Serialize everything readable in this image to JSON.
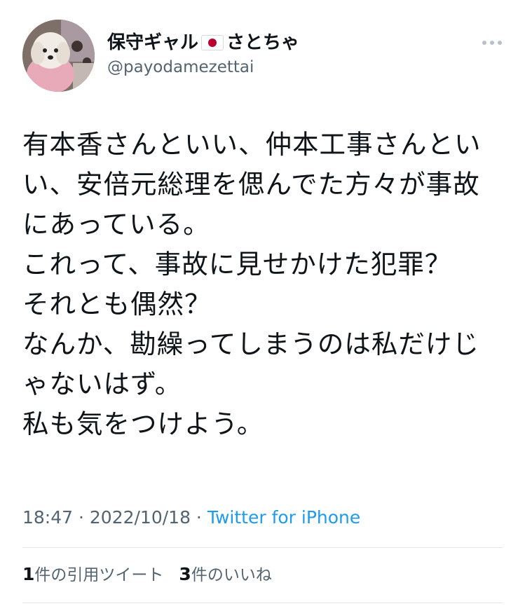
{
  "tweet": {
    "display_name_before_flag": "保守ギャル",
    "display_name_after_flag": "さとちゃ",
    "flag_icon": "japan-flag-icon",
    "handle": "@payodamezettai",
    "text": "有本香さんといい、仲本工事さんといい、安倍元総理を偲んでた方々が事故にあっている。\nこれって、事故に見せかけた犯罪？\nそれとも偶然？\nなんか、勘繰ってしまうのは私だけじゃないはず。\n私も気をつけよう。",
    "time": "18:47",
    "separator": " · ",
    "date": "2022/10/18",
    "source": "Twitter for iPhone",
    "quote_count": "1",
    "quote_label": "件の引用ツイート",
    "like_count": "3",
    "like_label": "件のいいね"
  },
  "colors": {
    "text": "#0f1419",
    "secondary": "#536471",
    "accent": "#1d9bf0",
    "divider": "#e4e8eb"
  }
}
